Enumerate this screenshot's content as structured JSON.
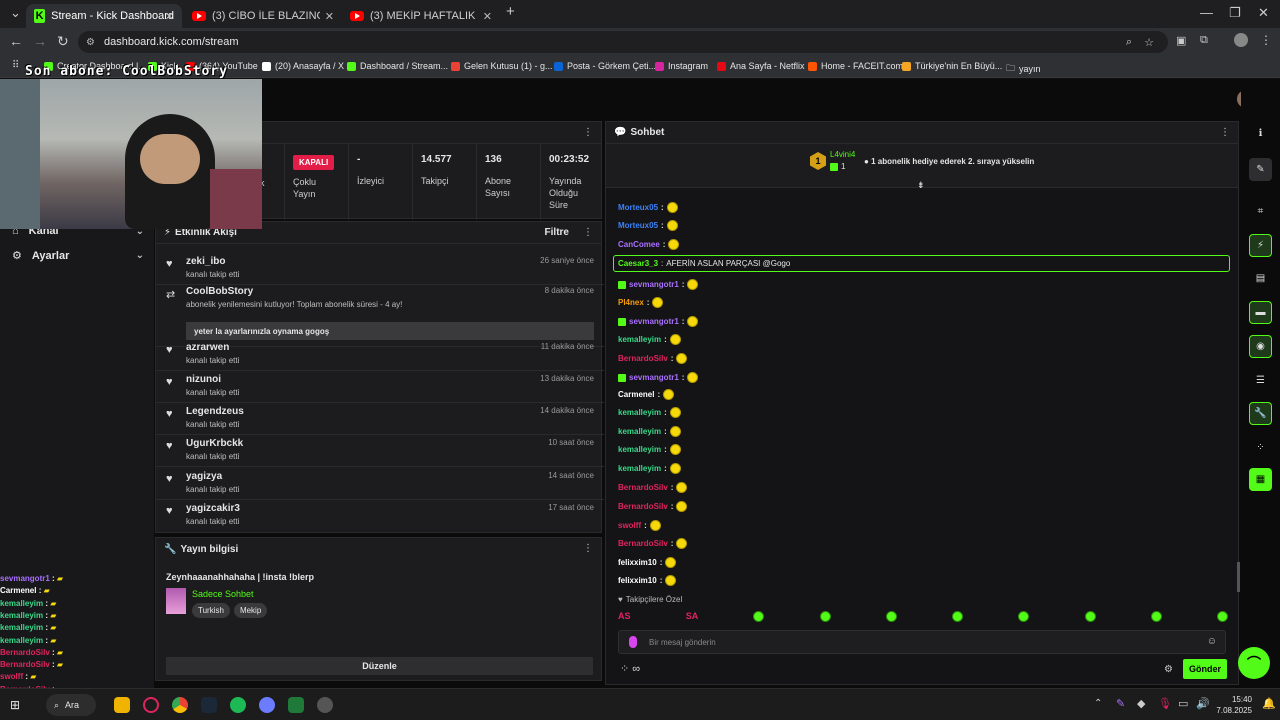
{
  "browser": {
    "tabs": [
      {
        "label": "Stream - Kick Dashboard",
        "active": true,
        "icon": "kick-icon"
      },
      {
        "label": "(3) CİBO İLE BLAZING SAILS VE",
        "active": false,
        "icon": "youtube-icon"
      },
      {
        "label": "(3) MEKİP HAFTALIK KOMİK AN",
        "active": false,
        "icon": "youtube-icon"
      }
    ],
    "url": "dashboard.kick.com/stream",
    "bookmarks": [
      "Creator Dashboard |...",
      "Kick",
      "(364) YouTube",
      "(20) Anasayfa / X",
      "Dashboard / Stream...",
      "Gelen Kutusu (1) - g...",
      "Posta - Görkem Çeti...",
      "Instagram",
      "Ana Sayfa - Netflix",
      "Home - FACEIT.com",
      "Türkiye'nin En Büyü...",
      "yayın"
    ]
  },
  "overlay": {
    "last_sub": "Son abone: CoolBobStory"
  },
  "sidebar": {
    "items": [
      {
        "label": "Kanal"
      },
      {
        "label": "Ayarlar"
      }
    ],
    "overlay_chat": [
      {
        "user": "sevmangotr1",
        "color": "#a970ff"
      },
      {
        "user": "Carmenel",
        "color": "#ffffff"
      },
      {
        "user": "kemalleyim",
        "color": "#39d98a"
      },
      {
        "user": "kemalleyim",
        "color": "#39d98a"
      },
      {
        "user": "kemalleyim",
        "color": "#39d98a"
      },
      {
        "user": "kemalleyim",
        "color": "#39d98a"
      },
      {
        "user": "BernardoSilv",
        "color": "#e0245e"
      },
      {
        "user": "BernardoSilv",
        "color": "#e0245e"
      },
      {
        "user": "swolff",
        "color": "#e0245e"
      },
      {
        "user": "BernardoSilv",
        "color": "#e0245e"
      },
      {
        "user": "felixxim10",
        "color": "#ffffff"
      },
      {
        "user": "felixxim10",
        "color": "#ffffff"
      }
    ]
  },
  "stats": {
    "status_badge": "KAPALI",
    "status_label": "Çoklu Yayın",
    "viewers_value": "-",
    "viewers_label": "İzleyici",
    "followers_value": "14.577",
    "followers_label": "Takipçi",
    "subs_value": "136",
    "subs_label": "Abone Sayısı",
    "uptime_value": "00:23:52",
    "uptime_label": "Yayında Olduğu Süre",
    "partial_left": "k"
  },
  "activity": {
    "title": "Etkinlik Akışı",
    "filter": "Filtre",
    "items": [
      {
        "user": "zeki_ibo",
        "text": "kanalı takip etti",
        "time": "26 saniye önce",
        "icon": "heart-icon"
      },
      {
        "user": "CoolBobStory",
        "text": "abonelik yenilemesini kutluyor! Toplam abonelik süresi - 4 ay!",
        "time": "8 dakika önce",
        "icon": "renew-icon",
        "message": "yeter la ayarlarınızla oynama gogoş"
      },
      {
        "user": "azrarwen",
        "text": "kanalı takip etti",
        "time": "11 dakika önce",
        "icon": "heart-icon"
      },
      {
        "user": "nizunoi",
        "text": "kanalı takip etti",
        "time": "13 dakika önce",
        "icon": "heart-icon"
      },
      {
        "user": "Legendzeus",
        "text": "kanalı takip etti",
        "time": "14 dakika önce",
        "icon": "heart-icon"
      },
      {
        "user": "UgurKrbckk",
        "text": "kanalı takip etti",
        "time": "10 saat önce",
        "icon": "heart-icon"
      },
      {
        "user": "yagizya",
        "text": "kanalı takip etti",
        "time": "14 saat önce",
        "icon": "heart-icon"
      },
      {
        "user": "yagizcakir3",
        "text": "kanalı takip etti",
        "time": "17 saat önce",
        "icon": "heart-icon"
      }
    ]
  },
  "stream_info": {
    "title": "Yayın bilgisi",
    "stream_title": "Zeynhaaanahhahaha | !insta !blerp",
    "category": "Sadece Sohbet",
    "tags": [
      "Turkish",
      "Mekip"
    ],
    "edit_button": "Düzenle"
  },
  "chat": {
    "title": "Sohbet",
    "pinned_user": "L4vini4",
    "pinned_rank": "1",
    "pinned_count": "1",
    "pinned_text": "1 abonelik hediye ederek 2. sıraya yükselin",
    "highlight": {
      "user": "Caesar3_3",
      "text": "AFERİN ASLAN PARÇASI @Gogo"
    },
    "messages": [
      {
        "user": "Morteux05",
        "color": "#3b82f6",
        "sub": false
      },
      {
        "user": "Morteux05",
        "color": "#3b82f6",
        "sub": false
      },
      {
        "user": "CanComee",
        "color": "#a970ff",
        "sub": false
      },
      {
        "user": "sevmangotr1",
        "color": "#a970ff",
        "sub": true
      },
      {
        "user": "Pl4nex",
        "color": "#f59e0b",
        "sub": false
      },
      {
        "user": "sevmangotr1",
        "color": "#a970ff",
        "sub": true
      },
      {
        "user": "kemalleyim",
        "color": "#39d98a",
        "sub": false
      },
      {
        "user": "BernardoSilv",
        "color": "#e0245e",
        "sub": false
      },
      {
        "user": "sevmangotr1",
        "color": "#a970ff",
        "sub": true
      },
      {
        "user": "Carmenel",
        "color": "#ffffff",
        "sub": false
      },
      {
        "user": "kemalleyim",
        "color": "#39d98a",
        "sub": false
      },
      {
        "user": "kemalleyim",
        "color": "#39d98a",
        "sub": false
      },
      {
        "user": "kemalleyim",
        "color": "#39d98a",
        "sub": false
      },
      {
        "user": "kemalleyim",
        "color": "#39d98a",
        "sub": false
      },
      {
        "user": "BernardoSilv",
        "color": "#e0245e",
        "sub": false
      },
      {
        "user": "BernardoSilv",
        "color": "#e0245e",
        "sub": false
      },
      {
        "user": "swolff",
        "color": "#e0245e",
        "sub": false
      },
      {
        "user": "BernardoSilv",
        "color": "#e0245e",
        "sub": false
      },
      {
        "user": "felixxim10",
        "color": "#ffffff",
        "sub": false
      },
      {
        "user": "felixxim10",
        "color": "#ffffff",
        "sub": false
      }
    ],
    "followers_only": "Takipçilere Özel",
    "input_placeholder": "Bir mesaj gönderin",
    "send_button": "Gönder"
  },
  "taskbar": {
    "search": "Ara",
    "time": "15:40",
    "date": "7.08.2025"
  },
  "accent": "#53fc18"
}
